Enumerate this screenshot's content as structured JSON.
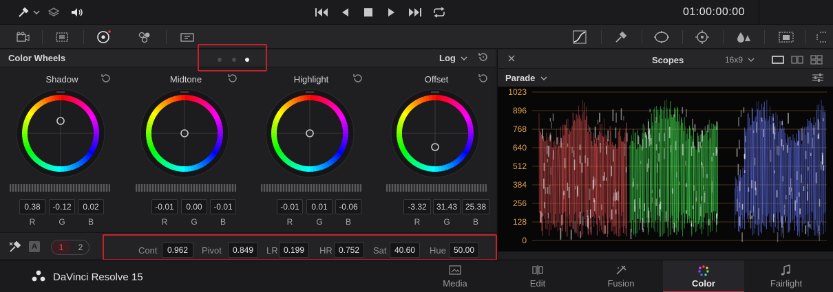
{
  "transport": {
    "timecode": "01:00:00:00"
  },
  "colors": {
    "accent": "#c8202a",
    "active_tab": "#d02f38"
  },
  "color_wheels": {
    "title": "Color Wheels",
    "mode": "Log",
    "page_dots": {
      "count": 3,
      "active": 3
    },
    "wheels": [
      {
        "name": "Shadow",
        "values": [
          "0.38",
          "-0.12",
          "0.02"
        ],
        "labels": [
          "R",
          "G",
          "B"
        ],
        "puck": [
          0.0,
          0.45
        ]
      },
      {
        "name": "Midtone",
        "values": [
          "-0.01",
          "0.00",
          "-0.01"
        ],
        "labels": [
          "R",
          "G",
          "B"
        ],
        "puck": [
          0.0,
          0.0
        ]
      },
      {
        "name": "Highlight",
        "values": [
          "-0.01",
          "0.01",
          "-0.06"
        ],
        "labels": [
          "R",
          "G",
          "B"
        ],
        "puck": [
          0.0,
          0.0
        ]
      },
      {
        "name": "Offset",
        "values": [
          "-3.32",
          "31.43",
          "25.38"
        ],
        "labels": [
          "R",
          "G",
          "B"
        ],
        "puck": [
          0.0,
          -0.5
        ]
      }
    ]
  },
  "adjustments": {
    "page_buttons": [
      "1",
      "2"
    ],
    "a_label": "A",
    "items": [
      {
        "label": "Cont",
        "value": "0.962"
      },
      {
        "label": "Pivot",
        "value": "0.849"
      },
      {
        "label": "LR",
        "value": "0.199"
      },
      {
        "label": "HR",
        "value": "0.752"
      },
      {
        "label": "Sat",
        "value": "40.60"
      },
      {
        "label": "Hue",
        "value": "50.00"
      }
    ]
  },
  "scopes": {
    "title": "Scopes",
    "ratio": "16x9",
    "mode": "Parade",
    "scale": [
      "1023",
      "896",
      "768",
      "640",
      "512",
      "384",
      "256",
      "128",
      "0"
    ]
  },
  "pagebar": {
    "app_name": "DaVinci Resolve 15",
    "tabs": [
      {
        "label": "Media",
        "icon": "media-icon"
      },
      {
        "label": "Edit",
        "icon": "edit-icon"
      },
      {
        "label": "Fusion",
        "icon": "fusion-icon"
      },
      {
        "label": "Color",
        "icon": "color-icon",
        "active": true
      },
      {
        "label": "Fairlight",
        "icon": "fairlight-icon"
      }
    ]
  }
}
